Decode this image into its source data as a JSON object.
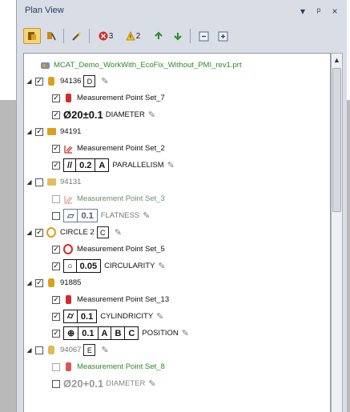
{
  "panel": {
    "title": "Plan View",
    "pin_glyph": "▾",
    "dock_glyph": "ᵖ",
    "close_glyph": "×"
  },
  "toolbar": {
    "badge_error_count": "3",
    "badge_warning_count": "2"
  },
  "tree": {
    "root": "MCAT_Demo_WorkWith_EcoFix_Without_PMI_rev1.prt",
    "rows": [
      {
        "label": "94136",
        "tag": "D"
      },
      {
        "label": "Measurement Point Set_7"
      },
      {
        "label": "Ø20±0.1",
        "text": "DIAMETER"
      },
      {
        "label": "94191"
      },
      {
        "label": "Measurement Point Set_2"
      },
      {
        "label": "0.2",
        "datum": "A",
        "text": "PARALLELISM"
      },
      {
        "label": "94131"
      },
      {
        "label": "Measurement Point Set_3"
      },
      {
        "label": "0.1",
        "text": "FLATNESS"
      },
      {
        "label": "CIRCLE 2",
        "tag": "C"
      },
      {
        "label": "Measurement Point Set_5"
      },
      {
        "label": "0.05",
        "text": "CIRCULARITY"
      },
      {
        "label": "91885"
      },
      {
        "label": "Measurement Point Set_13"
      },
      {
        "label": "0.1",
        "text": "CYLINDRICITY"
      },
      {
        "label": "0.1",
        "d1": "A",
        "d2": "B",
        "d3": "C",
        "text": "POSITION"
      },
      {
        "label": "94067",
        "tag": "E"
      },
      {
        "label": "Measurement Point Set_8"
      },
      {
        "label": "Ø20+0.1",
        "text": "DIAMETER"
      }
    ]
  }
}
